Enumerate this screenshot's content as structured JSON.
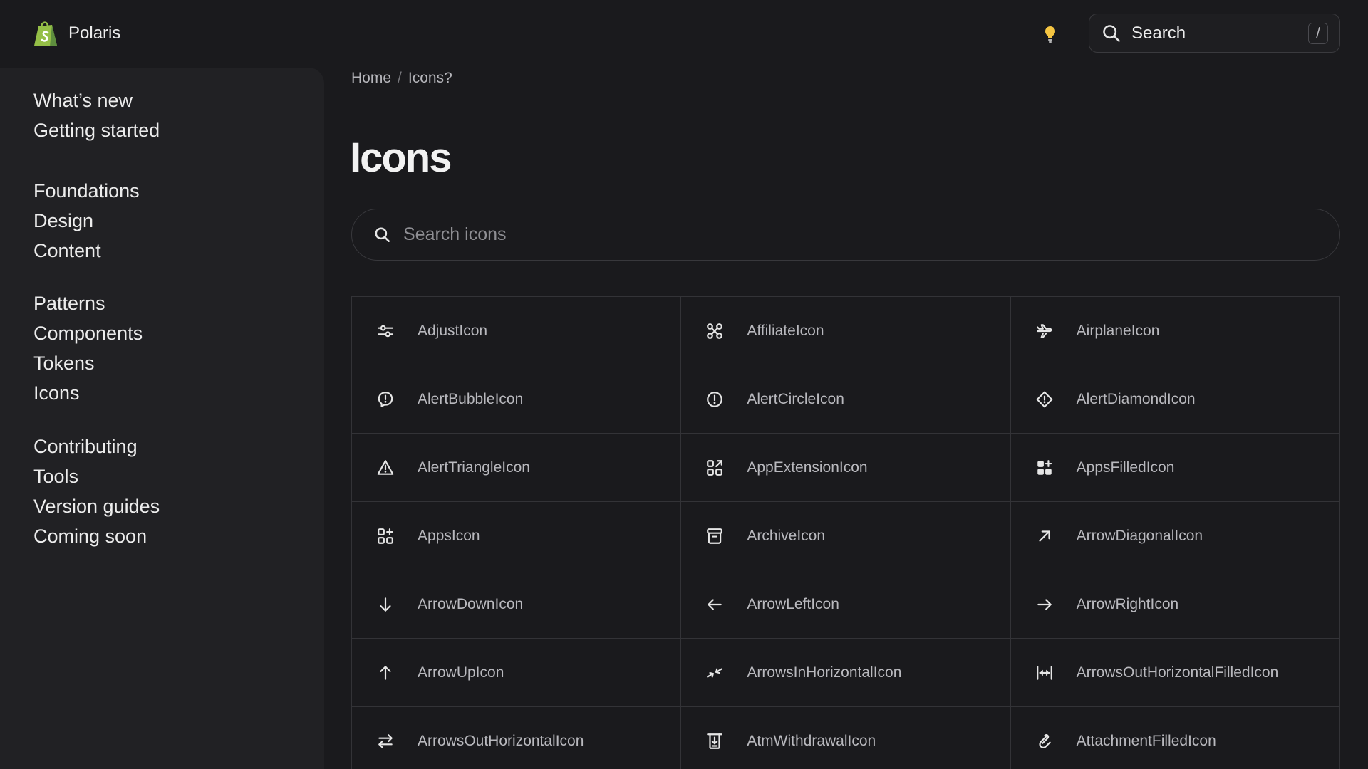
{
  "header": {
    "app_name": "Polaris",
    "search_label": "Search",
    "search_shortcut": "/"
  },
  "sidebar": {
    "groups": [
      [
        "What’s new",
        "Getting started"
      ],
      [
        "Foundations",
        "Design",
        "Content"
      ],
      [
        "Patterns",
        "Components",
        "Tokens",
        "Icons"
      ],
      [
        "Contributing",
        "Tools",
        "Version guides",
        "Coming soon"
      ]
    ]
  },
  "breadcrumb": {
    "home": "Home",
    "separator": "/",
    "current": "Icons?"
  },
  "page": {
    "title": "Icons"
  },
  "icon_search": {
    "placeholder": "Search icons",
    "value": ""
  },
  "icons": [
    {
      "name": "AdjustIcon",
      "icon": "adjust-icon"
    },
    {
      "name": "AffiliateIcon",
      "icon": "affiliate-icon"
    },
    {
      "name": "AirplaneIcon",
      "icon": "airplane-icon"
    },
    {
      "name": "AlertBubbleIcon",
      "icon": "alert-bubble-icon"
    },
    {
      "name": "AlertCircleIcon",
      "icon": "alert-circle-icon"
    },
    {
      "name": "AlertDiamondIcon",
      "icon": "alert-diamond-icon"
    },
    {
      "name": "AlertTriangleIcon",
      "icon": "alert-triangle-icon"
    },
    {
      "name": "AppExtensionIcon",
      "icon": "app-extension-icon"
    },
    {
      "name": "AppsFilledIcon",
      "icon": "apps-filled-icon"
    },
    {
      "name": "AppsIcon",
      "icon": "apps-icon"
    },
    {
      "name": "ArchiveIcon",
      "icon": "archive-icon"
    },
    {
      "name": "ArrowDiagonalIcon",
      "icon": "arrow-diagonal-icon"
    },
    {
      "name": "ArrowDownIcon",
      "icon": "arrow-down-icon"
    },
    {
      "name": "ArrowLeftIcon",
      "icon": "arrow-left-icon"
    },
    {
      "name": "ArrowRightIcon",
      "icon": "arrow-right-icon"
    },
    {
      "name": "ArrowUpIcon",
      "icon": "arrow-up-icon"
    },
    {
      "name": "ArrowsInHorizontalIcon",
      "icon": "arrows-in-horizontal-icon"
    },
    {
      "name": "ArrowsOutHorizontalFilledIcon",
      "icon": "arrows-out-horizontal-filled-icon"
    },
    {
      "name": "ArrowsOutHorizontalIcon",
      "icon": "arrows-out-horizontal-icon"
    },
    {
      "name": "AtmWithdrawalIcon",
      "icon": "atm-withdrawal-icon"
    },
    {
      "name": "AttachmentFilledIcon",
      "icon": "attachment-filled-icon"
    }
  ],
  "colors": {
    "background": "#1a1a1d",
    "sidebar": "#212124",
    "border": "#333337",
    "text": "#ececec",
    "muted_text": "#b9b9be",
    "brand_green": "#95bf47"
  }
}
